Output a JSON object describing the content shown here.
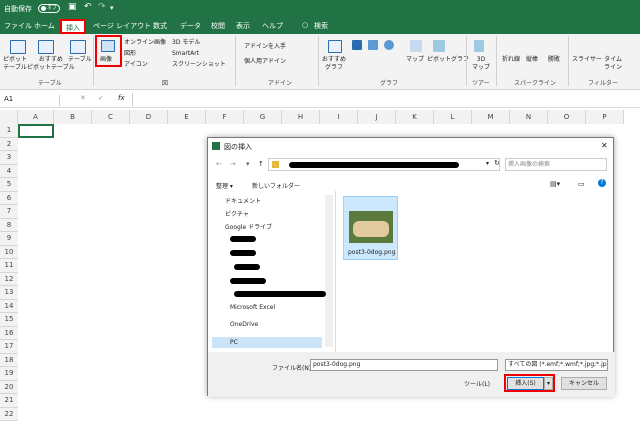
{
  "titlebar": {
    "autosave": "自動保存",
    "toggle": "オフ",
    "undo_label": "↶",
    "redo_label": "↷",
    "search": "検索"
  },
  "tabs": [
    "ファイル",
    "ホーム",
    "挿入",
    "ページ レイアウト",
    "数式",
    "データ",
    "校閲",
    "表示",
    "ヘルプ"
  ],
  "ribbon": {
    "pivot": "ピボット\nテーブル",
    "rec_pivot": "おすすめ\nピボットテーブル",
    "table": "テーブル",
    "image": "画像",
    "online_image": "オンライン画像",
    "shapes": "図形",
    "icons": "アイコン",
    "model3d": "3D モデル",
    "smartart": "SmartArt",
    "screenshot": "スクリーンショット",
    "get_addins": "アドインを入手",
    "my_addins": "個人用アドイン",
    "rec_charts": "おすすめ\nグラフ",
    "maps": "マップ",
    "pivot_chart": "ピボットグラフ",
    "map3d": "3D\nマップ",
    "line": "折れ線",
    "column": "縦棒",
    "winloss": "勝敗",
    "slicer": "スライサー",
    "timeline": "タイム\nライン",
    "groups": {
      "table": "テーブル",
      "illust": "図",
      "addins": "アドイン",
      "charts": "グラフ",
      "tours": "ツアー",
      "sparklines": "スパークライン",
      "filters": "フィルター"
    }
  },
  "formula": {
    "namebox": "A1",
    "cancel": "✕",
    "enter": "✓",
    "fx": "fx"
  },
  "grid": {
    "columns": [
      "A",
      "B",
      "C",
      "D",
      "E",
      "F",
      "G",
      "H",
      "I",
      "J",
      "K",
      "L",
      "M",
      "N",
      "O",
      "P"
    ],
    "rows": [
      "1",
      "2",
      "3",
      "4",
      "5",
      "6",
      "7",
      "8",
      "9",
      "10",
      "11",
      "12",
      "13",
      "14",
      "15",
      "16",
      "17",
      "18",
      "19",
      "20",
      "21",
      "22"
    ]
  },
  "dialog": {
    "title": "図の挿入",
    "close": "✕",
    "search_placeholder": "挿入画像の検索",
    "organize": "整理 ▾",
    "new_folder": "新しいフォルダー",
    "nav": [
      "ドキュメント",
      "ピクチャ",
      "Google ドライブ",
      "Microsoft Excel",
      "OneDrive",
      "PC"
    ],
    "file_name": "post3-0dog.png",
    "filename_label": "ファイル名(N):",
    "filename_value": "post3-0dog.png",
    "filetype": "すべての図 (*.emf;*.wmf;*.jpg;*.jp",
    "tools": "ツール(L)",
    "insert": "挿入(S)",
    "cancel": "キャンセル"
  },
  "colors": {
    "brand": "#217346",
    "highlight": "#e00000",
    "accent": "#0078d7"
  }
}
